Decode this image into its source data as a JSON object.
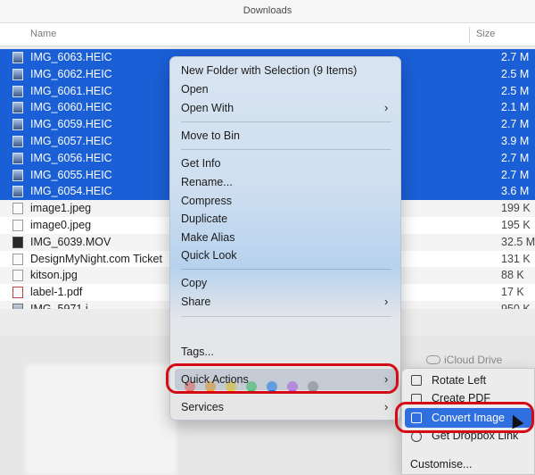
{
  "window": {
    "title": "Downloads"
  },
  "columns": {
    "name": "Name",
    "size": "Size"
  },
  "files": [
    {
      "name": "IMG_6063.HEIC",
      "size": "2.7 M",
      "selected": true,
      "kind": "img"
    },
    {
      "name": "IMG_6062.HEIC",
      "size": "2.5 M",
      "selected": true,
      "kind": "img"
    },
    {
      "name": "IMG_6061.HEIC",
      "size": "2.5 M",
      "selected": true,
      "kind": "img"
    },
    {
      "name": "IMG_6060.HEIC",
      "size": "2.1 M",
      "selected": true,
      "kind": "img"
    },
    {
      "name": "IMG_6059.HEIC",
      "size": "2.7 M",
      "selected": true,
      "kind": "img"
    },
    {
      "name": "IMG_6057.HEIC",
      "size": "3.9 M",
      "selected": true,
      "kind": "img"
    },
    {
      "name": "IMG_6056.HEIC",
      "size": "2.7 M",
      "selected": true,
      "kind": "img"
    },
    {
      "name": "IMG_6055.HEIC",
      "size": "2.7 M",
      "selected": true,
      "kind": "img"
    },
    {
      "name": "IMG_6054.HEIC",
      "size": "3.6 M",
      "selected": true,
      "kind": "img"
    },
    {
      "name": "image1.jpeg",
      "size": "199 K",
      "selected": false,
      "kind": "doc"
    },
    {
      "name": "image0.jpeg",
      "size": "195 K",
      "selected": false,
      "kind": "doc"
    },
    {
      "name": "IMG_6039.MOV",
      "size": "32.5 M",
      "selected": false,
      "kind": "mov"
    },
    {
      "name": "DesignMyNight.com Ticket",
      "size": "131 K",
      "selected": false,
      "kind": "doc"
    },
    {
      "name": "kitson.jpg",
      "size": "88 K",
      "selected": false,
      "kind": "doc"
    },
    {
      "name": "label-1.pdf",
      "size": "17 K",
      "selected": false,
      "kind": "pdf"
    },
    {
      "name": "IMG_5971.j",
      "size": "950 K",
      "selected": false,
      "kind": "img"
    }
  ],
  "context_menu": {
    "new_folder": "New Folder with Selection (9 Items)",
    "open": "Open",
    "open_with": "Open With",
    "move_to_bin": "Move to Bin",
    "get_info": "Get Info",
    "rename": "Rename...",
    "compress": "Compress",
    "duplicate": "Duplicate",
    "make_alias": "Make Alias",
    "quick_look": "Quick Look",
    "copy": "Copy",
    "share": "Share",
    "tags": "Tags...",
    "quick_actions": "Quick Actions",
    "services": "Services",
    "arrow": "›",
    "tag_colors": [
      "#ff5f57",
      "#ff9f0a",
      "#ffd60a",
      "#30d158",
      "#0a84ff",
      "#bf5af2",
      "#8e8e93"
    ]
  },
  "submenu": {
    "rotate_left": "Rotate Left",
    "create_pdf": "Create PDF",
    "convert_image": "Convert Image",
    "get_dropbox_link": "Get Dropbox Link",
    "customise": "Customise..."
  },
  "sidebar": {
    "icloud_drive": "iCloud Drive"
  },
  "colors": {
    "selection": "#1b5fd6",
    "submenu_highlight": "#2f6fe0",
    "annotation": "#d40b14"
  }
}
